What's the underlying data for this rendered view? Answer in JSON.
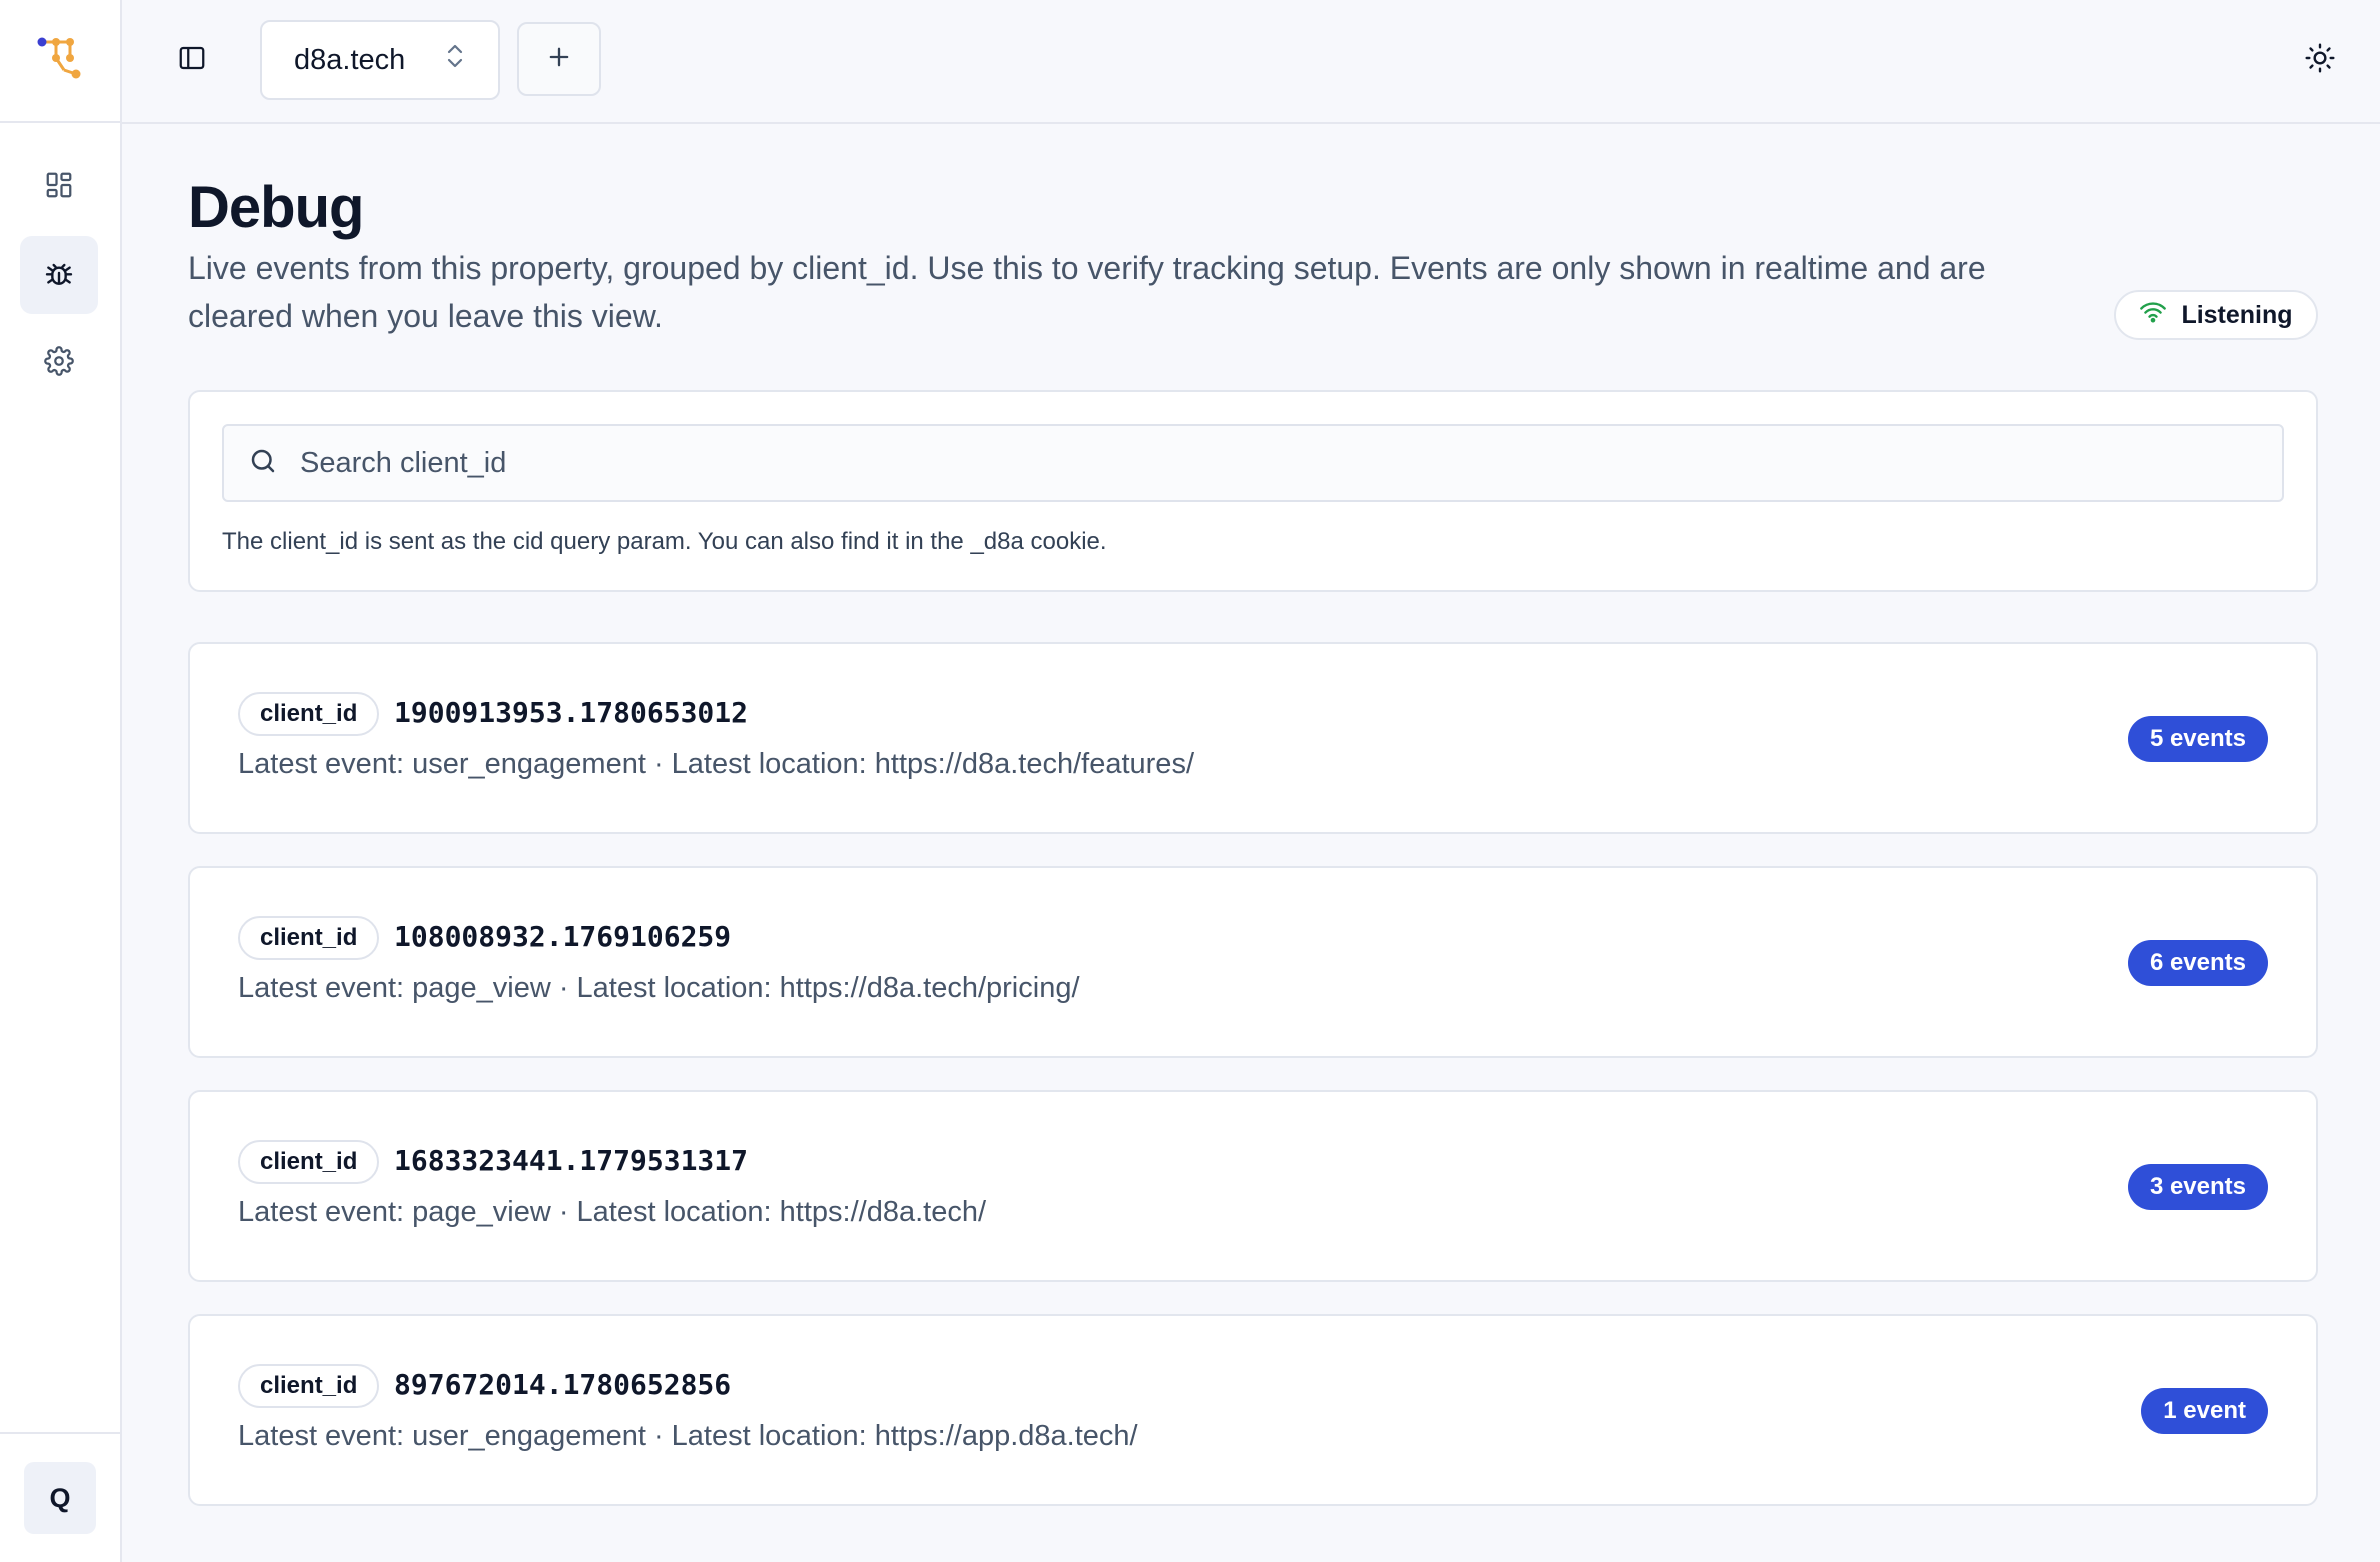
{
  "sidebar": {
    "logo": "d8a-logo",
    "items": [
      {
        "name": "dashboard",
        "icon": "dashboard-grid-icon",
        "active": false
      },
      {
        "name": "debug",
        "icon": "bug-icon",
        "active": true
      },
      {
        "name": "settings",
        "icon": "gear-icon",
        "active": false
      }
    ],
    "user_initial": "Q"
  },
  "topbar": {
    "property_name": "d8a.tech",
    "sidebar_toggle_icon": "sidebar-toggle-icon",
    "add_icon": "plus-icon",
    "theme_icon": "sun-icon"
  },
  "page": {
    "title": "Debug",
    "description": "Live events from this property, grouped by client_id. Use this to verify tracking setup. Events are only shown in realtime and are cleared when you leave this view.",
    "status": "Listening"
  },
  "search": {
    "placeholder": "Search client_id",
    "value": "",
    "hint": "The client_id is sent as the cid query param. You can also find it in the _d8a cookie."
  },
  "clients": [
    {
      "tag": "client_id",
      "id": "1900913953.1780653012",
      "meta": "Latest event: user_engagement · Latest location: https://d8a.tech/features/",
      "count": "5 events"
    },
    {
      "tag": "client_id",
      "id": "108008932.1769106259",
      "meta": "Latest event: page_view · Latest location: https://d8a.tech/pricing/",
      "count": "6 events"
    },
    {
      "tag": "client_id",
      "id": "1683323441.1779531317",
      "meta": "Latest event: page_view · Latest location: https://d8a.tech/",
      "count": "3 events"
    },
    {
      "tag": "client_id",
      "id": "897672014.1780652856",
      "meta": "Latest event: user_engagement · Latest location: https://app.d8a.tech/",
      "count": "1 event"
    }
  ],
  "colors": {
    "accent": "#2f4fd8",
    "listening": "#22a04b",
    "logo_blue": "#3b3fd1",
    "logo_orange": "#f0a640"
  }
}
